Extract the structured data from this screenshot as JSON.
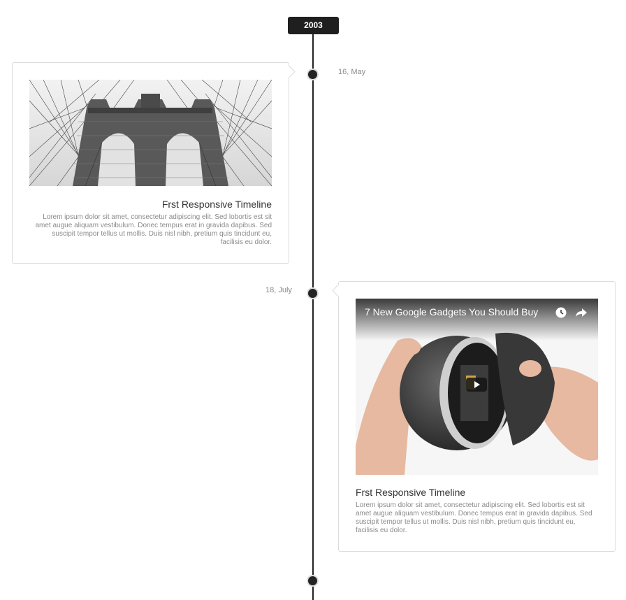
{
  "year": "2003",
  "events": [
    {
      "date": "16, May",
      "image": "bridge-photo",
      "title": "Frst Responsive Timeline",
      "text": "Lorem ipsum dolor sit amet, consectetur adipiscing elit. Sed lobortis est sit amet augue aliquam vestibulum. Donec tempus erat in gravida dapibus. Sed suscipit tempor tellus ut mollis. Duis nisl nibh, pretium quis tincidunt eu, facilisis eu dolor."
    },
    {
      "date": "18, July",
      "video_title": "7 New Google Gadgets You Should Buy",
      "title": "Frst Responsive Timeline",
      "text": "Lorem ipsum dolor sit amet, consectetur adipiscing elit. Sed lobortis est sit amet augue aliquam vestibulum. Donec tempus erat in gravida dapibus. Sed suscipit tempor tellus ut mollis. Duis nisl nibh, pretium quis tincidunt eu, facilisis eu dolor."
    }
  ],
  "icons": [
    "clock-icon",
    "share-icon",
    "play-icon"
  ],
  "colors": {
    "line": "#222222",
    "badge": "#1f1f1f",
    "muted": "#8a8a8a",
    "border": "#dcdcdc"
  }
}
